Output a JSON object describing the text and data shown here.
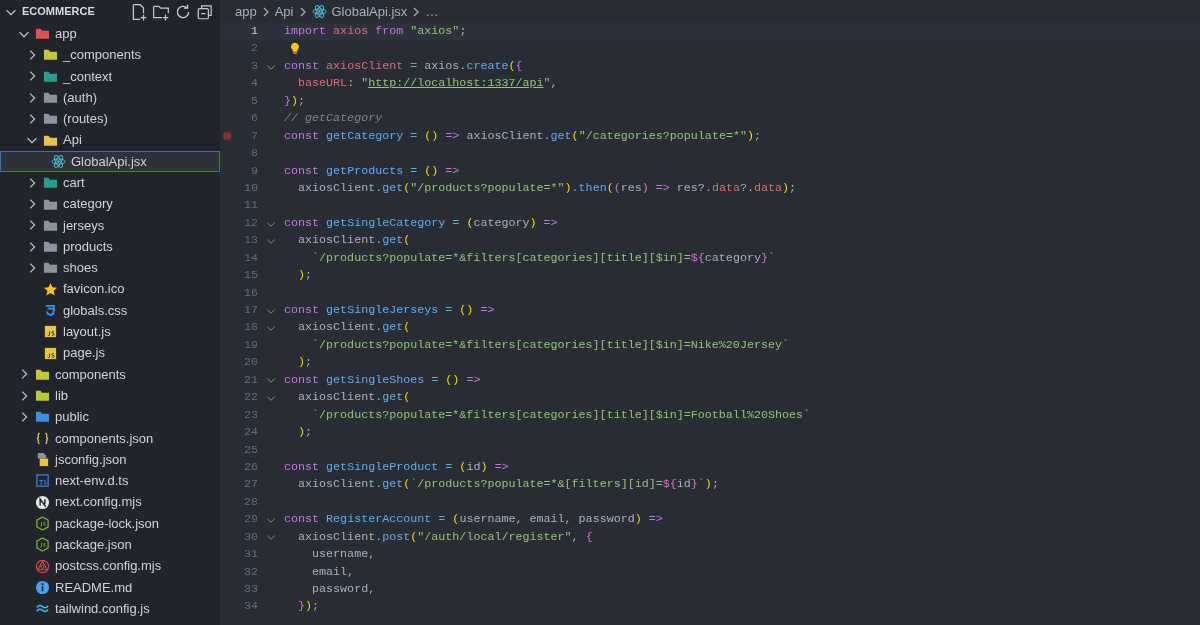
{
  "explorer": {
    "title": "ECOMMERCE",
    "expanded": true,
    "items": [
      {
        "label": "app",
        "kind": "folder",
        "color": "#e05252",
        "expanded": true,
        "selected": false,
        "children": [
          {
            "label": "_components",
            "kind": "folder",
            "color": "#c5c736",
            "expanded": false,
            "selected": false
          },
          {
            "label": "_context",
            "kind": "folder",
            "color": "#2a9d8f",
            "expanded": false,
            "selected": false
          },
          {
            "label": "(auth)",
            "kind": "folder",
            "color": "#8a949e",
            "expanded": false,
            "selected": false
          },
          {
            "label": "(routes)",
            "kind": "folder",
            "color": "#8a949e",
            "expanded": false,
            "selected": false
          },
          {
            "label": "Api",
            "kind": "folder",
            "color": "#e8c547",
            "expanded": true,
            "selected": false,
            "children": [
              {
                "label": "GlobalApi.jsx",
                "kind": "react",
                "selected": true
              }
            ]
          },
          {
            "label": "cart",
            "kind": "folder",
            "color": "#2a9d8f",
            "expanded": false,
            "selected": false
          },
          {
            "label": "category",
            "kind": "folder",
            "color": "#8a949e",
            "expanded": false,
            "selected": false
          },
          {
            "label": "jerseys",
            "kind": "folder",
            "color": "#8a949e",
            "expanded": false,
            "selected": false
          },
          {
            "label": "products",
            "kind": "folder",
            "color": "#8a949e",
            "expanded": false,
            "selected": false
          },
          {
            "label": "shoes",
            "kind": "folder",
            "color": "#8a949e",
            "expanded": false,
            "selected": false
          },
          {
            "label": "favicon.ico",
            "kind": "star",
            "selected": false
          },
          {
            "label": "globals.css",
            "kind": "css",
            "selected": false
          },
          {
            "label": "layout.js",
            "kind": "js",
            "selected": false
          },
          {
            "label": "page.js",
            "kind": "js",
            "selected": false
          }
        ]
      },
      {
        "label": "components",
        "kind": "folder",
        "color": "#c5c736",
        "expanded": false,
        "selected": false
      },
      {
        "label": "lib",
        "kind": "folder",
        "color": "#b8c93a",
        "expanded": false,
        "selected": false
      },
      {
        "label": "public",
        "kind": "folder",
        "color": "#3f8fe0",
        "expanded": false,
        "selected": false
      },
      {
        "label": "components.json",
        "kind": "json",
        "selected": false
      },
      {
        "label": "jsconfig.json",
        "kind": "jsconfig",
        "selected": false
      },
      {
        "label": "next-env.d.ts",
        "kind": "ts",
        "selected": false
      },
      {
        "label": "next.config.mjs",
        "kind": "next",
        "selected": false
      },
      {
        "label": "package-lock.json",
        "kind": "node",
        "selected": false
      },
      {
        "label": "package.json",
        "kind": "node",
        "selected": false
      },
      {
        "label": "postcss.config.mjs",
        "kind": "postcss",
        "selected": false
      },
      {
        "label": "README.md",
        "kind": "info",
        "selected": false
      },
      {
        "label": "tailwind.config.js",
        "kind": "tailwind",
        "selected": false
      }
    ]
  },
  "breadcrumbs": [
    {
      "label": "app",
      "kind": "plain"
    },
    {
      "label": "Api",
      "kind": "plain"
    },
    {
      "label": "GlobalApi.jsx",
      "kind": "react"
    },
    {
      "label": "…",
      "kind": "plain"
    }
  ],
  "lines": [
    {
      "n": "1",
      "fold": false,
      "breakpoint": false,
      "hint": false,
      "current": true,
      "tokens": [
        {
          "text": "import ",
          "kind": "kw"
        },
        {
          "text": "axios ",
          "kind": "var"
        },
        {
          "text": "from ",
          "kind": "kw"
        },
        {
          "text": "\"axios\"",
          "kind": "str"
        },
        {
          "text": ";",
          "kind": "p"
        }
      ]
    },
    {
      "n": "2",
      "fold": false,
      "breakpoint": false,
      "hint": true,
      "current": false
    },
    {
      "n": "3",
      "fold": true,
      "breakpoint": false,
      "hint": false,
      "current": false,
      "tokens": [
        {
          "text": "const ",
          "kind": "kw"
        },
        {
          "text": "axiosClient",
          "kind": "var"
        },
        {
          "text": " = ",
          "kind": "op"
        },
        {
          "text": "axios.",
          "kind": "p"
        },
        {
          "text": "create",
          "kind": "fn"
        },
        {
          "text": "(",
          "kind": "b1"
        },
        {
          "text": "{",
          "kind": "b2"
        }
      ]
    },
    {
      "n": "4",
      "fold": false,
      "breakpoint": false,
      "hint": false,
      "current": false,
      "tokens": [
        {
          "text": "  baseURL",
          "kind": "prop"
        },
        {
          "text": ": \"",
          "kind": "str"
        },
        {
          "text": "http://localhost:1337/api",
          "kind": "url"
        },
        {
          "text": "\"",
          "kind": "str"
        },
        {
          "text": ",",
          "kind": "p"
        }
      ]
    },
    {
      "n": "5",
      "fold": false,
      "breakpoint": false,
      "hint": false,
      "current": false,
      "tokens": [
        {
          "text": "}",
          "kind": "b2"
        },
        {
          "text": ")",
          "kind": "b1"
        },
        {
          "text": ";",
          "kind": "p"
        }
      ]
    },
    {
      "n": "6",
      "fold": false,
      "breakpoint": false,
      "hint": false,
      "current": false,
      "tokens": [
        {
          "text": "// getCategory",
          "kind": "cm"
        }
      ]
    },
    {
      "n": "7",
      "fold": false,
      "breakpoint": true,
      "hint": false,
      "current": false,
      "tokens": [
        {
          "text": "const ",
          "kind": "kw"
        },
        {
          "text": "getCategory",
          "kind": "fn"
        },
        {
          "text": " = ",
          "kind": "op"
        },
        {
          "text": "()",
          "kind": "b1"
        },
        {
          "text": " =>",
          "kind": "kw"
        },
        {
          "text": " axiosClient.",
          "kind": "p"
        },
        {
          "text": "get",
          "kind": "fn"
        },
        {
          "text": "(",
          "kind": "b1"
        },
        {
          "text": "\"/categories?populate=*\"",
          "kind": "str"
        },
        {
          "text": ")",
          "kind": "b1"
        },
        {
          "text": ";",
          "kind": "p"
        }
      ]
    },
    {
      "n": "8",
      "fold": false,
      "breakpoint": false,
      "hint": false,
      "current": false
    },
    {
      "n": "9",
      "fold": false,
      "breakpoint": false,
      "hint": false,
      "current": false,
      "tokens": [
        {
          "text": "const ",
          "kind": "kw"
        },
        {
          "text": "getProducts",
          "kind": "fn"
        },
        {
          "text": " = ",
          "kind": "op"
        },
        {
          "text": "()",
          "kind": "b1"
        },
        {
          "text": " =>",
          "kind": "kw"
        }
      ]
    },
    {
      "n": "10",
      "fold": false,
      "breakpoint": false,
      "hint": false,
      "current": false,
      "tokens": [
        {
          "text": "  axiosClient.",
          "kind": "p"
        },
        {
          "text": "get",
          "kind": "fn"
        },
        {
          "text": "(",
          "kind": "b1"
        },
        {
          "text": "\"/products?populate=*\"",
          "kind": "str"
        },
        {
          "text": ")",
          "kind": "b1"
        },
        {
          "text": ".",
          "kind": "p"
        },
        {
          "text": "then",
          "kind": "fn"
        },
        {
          "text": "(",
          "kind": "b1"
        },
        {
          "text": "(",
          "kind": "b2"
        },
        {
          "text": "res",
          "kind": "p"
        },
        {
          "text": ")",
          "kind": "b2"
        },
        {
          "text": " =>",
          "kind": "kw"
        },
        {
          "text": " res?.",
          "kind": "p"
        },
        {
          "text": "data",
          "kind": "prop"
        },
        {
          "text": "?.",
          "kind": "p"
        },
        {
          "text": "data",
          "kind": "prop"
        },
        {
          "text": ")",
          "kind": "b1"
        },
        {
          "text": ";",
          "kind": "p"
        }
      ]
    },
    {
      "n": "11",
      "fold": false,
      "breakpoint": false,
      "hint": false,
      "current": false
    },
    {
      "n": "12",
      "fold": true,
      "breakpoint": false,
      "hint": false,
      "current": false,
      "tokens": [
        {
          "text": "const ",
          "kind": "kw"
        },
        {
          "text": "getSingleCategory",
          "kind": "fn"
        },
        {
          "text": " = ",
          "kind": "op"
        },
        {
          "text": "(",
          "kind": "b1"
        },
        {
          "text": "category",
          "kind": "p"
        },
        {
          "text": ")",
          "kind": "b1"
        },
        {
          "text": " =>",
          "kind": "kw"
        }
      ]
    },
    {
      "n": "13",
      "fold": true,
      "breakpoint": false,
      "hint": false,
      "current": false,
      "tokens": [
        {
          "text": "  axiosClient.",
          "kind": "p"
        },
        {
          "text": "get",
          "kind": "fn"
        },
        {
          "text": "(",
          "kind": "b1"
        }
      ]
    },
    {
      "n": "14",
      "fold": false,
      "breakpoint": false,
      "hint": false,
      "current": false,
      "tokens": [
        {
          "text": "    `/products?populate=*&filters[categories][title][$in]=",
          "kind": "str"
        },
        {
          "text": "${",
          "kind": "b2"
        },
        {
          "text": "category",
          "kind": "p"
        },
        {
          "text": "}",
          "kind": "b2"
        },
        {
          "text": "`",
          "kind": "str"
        }
      ]
    },
    {
      "n": "15",
      "fold": false,
      "breakpoint": false,
      "hint": false,
      "current": false,
      "tokens": [
        {
          "text": "  )",
          "kind": "b1"
        },
        {
          "text": ";",
          "kind": "p"
        }
      ]
    },
    {
      "n": "16",
      "fold": false,
      "breakpoint": false,
      "hint": false,
      "current": false
    },
    {
      "n": "17",
      "fold": true,
      "breakpoint": false,
      "hint": false,
      "current": false,
      "tokens": [
        {
          "text": "const ",
          "kind": "kw"
        },
        {
          "text": "getSingleJerseys",
          "kind": "fn"
        },
        {
          "text": " = ",
          "kind": "op"
        },
        {
          "text": "()",
          "kind": "b1"
        },
        {
          "text": " =>",
          "kind": "kw"
        }
      ]
    },
    {
      "n": "18",
      "fold": true,
      "breakpoint": false,
      "hint": false,
      "current": false,
      "tokens": [
        {
          "text": "  axiosClient.",
          "kind": "p"
        },
        {
          "text": "get",
          "kind": "fn"
        },
        {
          "text": "(",
          "kind": "b1"
        }
      ]
    },
    {
      "n": "19",
      "fold": false,
      "breakpoint": false,
      "hint": false,
      "current": false,
      "tokens": [
        {
          "text": "    `/products?populate=*&filters[categories][title][$in]=Nike%20Jersey`",
          "kind": "str"
        }
      ]
    },
    {
      "n": "20",
      "fold": false,
      "breakpoint": false,
      "hint": false,
      "current": false,
      "tokens": [
        {
          "text": "  )",
          "kind": "b1"
        },
        {
          "text": ";",
          "kind": "p"
        }
      ]
    },
    {
      "n": "21",
      "fold": true,
      "breakpoint": false,
      "hint": false,
      "current": false,
      "tokens": [
        {
          "text": "const ",
          "kind": "kw"
        },
        {
          "text": "getSingleShoes",
          "kind": "fn"
        },
        {
          "text": " = ",
          "kind": "op"
        },
        {
          "text": "()",
          "kind": "b1"
        },
        {
          "text": " =>",
          "kind": "kw"
        }
      ]
    },
    {
      "n": "22",
      "fold": true,
      "breakpoint": false,
      "hint": false,
      "current": false,
      "tokens": [
        {
          "text": "  axiosClient.",
          "kind": "p"
        },
        {
          "text": "get",
          "kind": "fn"
        },
        {
          "text": "(",
          "kind": "b1"
        }
      ]
    },
    {
      "n": "23",
      "fold": false,
      "breakpoint": false,
      "hint": false,
      "current": false,
      "tokens": [
        {
          "text": "    `/products?populate=*&filters[categories][title][$in]=Football%20Shoes`",
          "kind": "str"
        }
      ]
    },
    {
      "n": "24",
      "fold": false,
      "breakpoint": false,
      "hint": false,
      "current": false,
      "tokens": [
        {
          "text": "  )",
          "kind": "b1"
        },
        {
          "text": ";",
          "kind": "p"
        }
      ]
    },
    {
      "n": "25",
      "fold": false,
      "breakpoint": false,
      "hint": false,
      "current": false
    },
    {
      "n": "26",
      "fold": false,
      "breakpoint": false,
      "hint": false,
      "current": false,
      "tokens": [
        {
          "text": "const ",
          "kind": "kw"
        },
        {
          "text": "getSingleProduct",
          "kind": "fn"
        },
        {
          "text": " = ",
          "kind": "op"
        },
        {
          "text": "(",
          "kind": "b1"
        },
        {
          "text": "id",
          "kind": "p"
        },
        {
          "text": ")",
          "kind": "b1"
        },
        {
          "text": " =>",
          "kind": "kw"
        }
      ]
    },
    {
      "n": "27",
      "fold": false,
      "breakpoint": false,
      "hint": false,
      "current": false,
      "tokens": [
        {
          "text": "  axiosClient.",
          "kind": "p"
        },
        {
          "text": "get",
          "kind": "fn"
        },
        {
          "text": "(",
          "kind": "b1"
        },
        {
          "text": "`/products?populate=*&[filters][id]=",
          "kind": "str"
        },
        {
          "text": "${",
          "kind": "b2"
        },
        {
          "text": "id",
          "kind": "p"
        },
        {
          "text": "}",
          "kind": "b2"
        },
        {
          "text": "`",
          "kind": "str"
        },
        {
          "text": ")",
          "kind": "b1"
        },
        {
          "text": ";",
          "kind": "p"
        }
      ]
    },
    {
      "n": "28",
      "fold": false,
      "breakpoint": false,
      "hint": false,
      "current": false
    },
    {
      "n": "29",
      "fold": true,
      "breakpoint": false,
      "hint": false,
      "current": false,
      "tokens": [
        {
          "text": "const ",
          "kind": "kw"
        },
        {
          "text": "RegisterAccount",
          "kind": "fn"
        },
        {
          "text": " = ",
          "kind": "op"
        },
        {
          "text": "(",
          "kind": "b1"
        },
        {
          "text": "username, email, password",
          "kind": "p"
        },
        {
          "text": ")",
          "kind": "b1"
        },
        {
          "text": " =>",
          "kind": "kw"
        }
      ]
    },
    {
      "n": "30",
      "fold": true,
      "breakpoint": false,
      "hint": false,
      "current": false,
      "tokens": [
        {
          "text": "  axiosClient.",
          "kind": "p"
        },
        {
          "text": "post",
          "kind": "fn"
        },
        {
          "text": "(",
          "kind": "b1"
        },
        {
          "text": "\"/auth/local/register\"",
          "kind": "str"
        },
        {
          "text": ", ",
          "kind": "p"
        },
        {
          "text": "{",
          "kind": "b2"
        }
      ]
    },
    {
      "n": "31",
      "fold": false,
      "breakpoint": false,
      "hint": false,
      "current": false,
      "tokens": [
        {
          "text": "    username,",
          "kind": "p"
        }
      ]
    },
    {
      "n": "32",
      "fold": false,
      "breakpoint": false,
      "hint": false,
      "current": false,
      "tokens": [
        {
          "text": "    email,",
          "kind": "p"
        }
      ]
    },
    {
      "n": "33",
      "fold": false,
      "breakpoint": false,
      "hint": false,
      "current": false,
      "tokens": [
        {
          "text": "    password,",
          "kind": "p"
        }
      ]
    },
    {
      "n": "34",
      "fold": false,
      "breakpoint": false,
      "hint": false,
      "current": false,
      "tokens": [
        {
          "text": "  }",
          "kind": "b2"
        },
        {
          "text": ")",
          "kind": "b1"
        },
        {
          "text": ";",
          "kind": "p"
        }
      ]
    }
  ]
}
